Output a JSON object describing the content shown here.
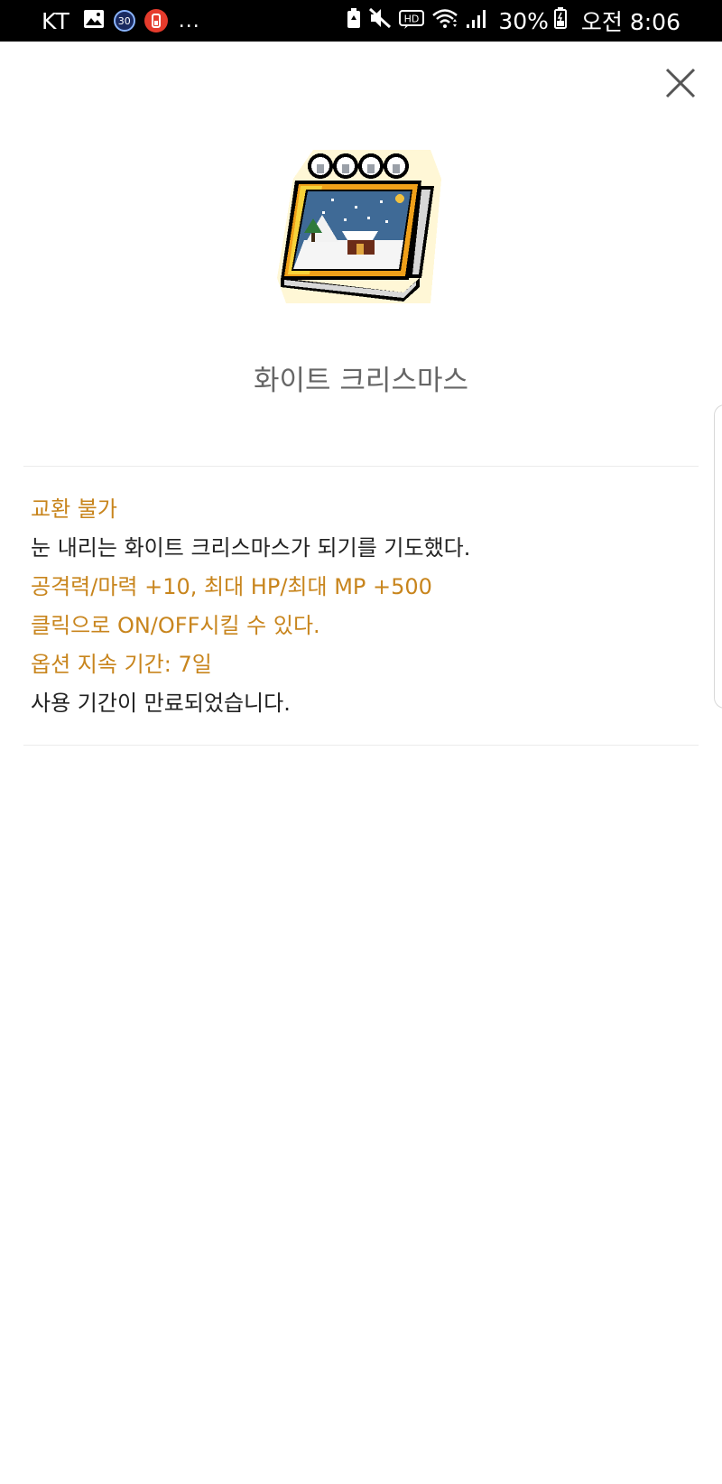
{
  "status_bar": {
    "carrier": "KT",
    "badge_30": "30",
    "more": "...",
    "battery_percent": "30%",
    "time": "오전 8:06",
    "hd_label": "HD",
    "icons": [
      "gallery-icon",
      "calendar-badge-icon",
      "notification-red-icon",
      "battery-saver-icon",
      "mute-icon",
      "hd-voice-icon",
      "wifi-icon",
      "signal-icon",
      "battery-icon"
    ]
  },
  "dialog": {
    "close_icon": "close-icon",
    "item_icon": "notebook-calendar-icon",
    "title": "화이트 크리스마스",
    "lines": [
      {
        "text": "교환 불가",
        "color": "#c8851d"
      },
      {
        "text": "눈 내리는 화이트 크리스마스가 되기를 기도했다.",
        "color": "#222222"
      },
      {
        "text": "공격력/마력 +10, 최대 HP/최대 MP +500",
        "color": "#c8851d"
      },
      {
        "text": "클릭으로 ON/OFF시킬 수 있다.",
        "color": "#c8851d"
      },
      {
        "text": "옵션 지속 기간: 7일",
        "color": "#c8851d"
      },
      {
        "text": "사용 기간이 만료되었습니다.",
        "color": "#222222"
      }
    ]
  },
  "colors": {
    "accent_orange": "#c8851d",
    "title_gray": "#666666",
    "status_bar_bg": "#000000"
  }
}
